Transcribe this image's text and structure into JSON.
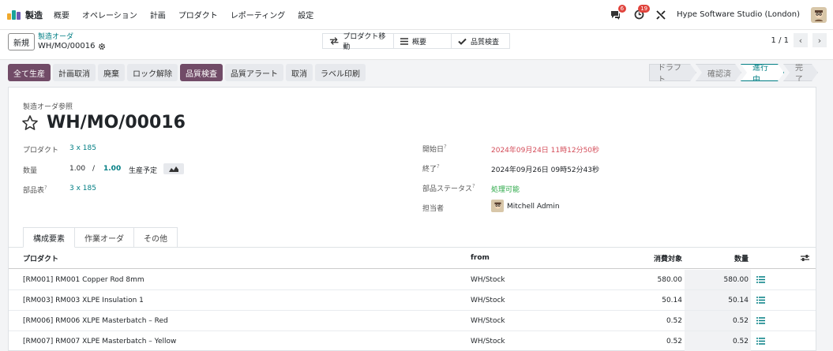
{
  "app": {
    "name": "製造",
    "menu": [
      "概要",
      "オペレーション",
      "計画",
      "プロダクト",
      "レポーティング",
      "設定"
    ]
  },
  "systray": {
    "messages_count": "6",
    "activities_count": "19",
    "company": "Hype Software Studio (London)"
  },
  "control": {
    "new_label": "新規",
    "breadcrumb_parent": "製造オーダ",
    "breadcrumb_current": "WH/MO/00016",
    "smart_buttons": [
      "プロダクト移動",
      "概要",
      "品質検査"
    ],
    "pager": "1 / 1"
  },
  "actions": [
    "全て生産",
    "計画取消",
    "廃棄",
    "ロック解除",
    "品質検査",
    "品質アラート",
    "取消",
    "ラベル印刷"
  ],
  "stages": [
    "ドラフト",
    "確認済",
    "進行中",
    "完了"
  ],
  "form": {
    "ref_label": "製造オーダ参照",
    "title": "WH/MO/00016",
    "product_label": "プロダクト",
    "product_value": "3 x 185",
    "qty_label": "数量",
    "qty_value": "1.00",
    "qty_sep": "/",
    "qty_target": "1.00",
    "forecast_label": "生産予定",
    "bom_label": "部品表",
    "bom_value": "3 x 185",
    "start_label": "開始日",
    "start_value": "2024年09月24日 11時12分50秒",
    "end_label": "終了",
    "end_value": "2024年09月26日 09時52分43秒",
    "component_status_label": "部品ステータス",
    "component_status_value": "処理可能",
    "responsible_label": "担当者",
    "responsible_value": "Mitchell Admin",
    "help_mark": "?"
  },
  "tabs": [
    "構成要素",
    "作業オーダ",
    "その他"
  ],
  "table": {
    "headers": {
      "product": "プロダクト",
      "from": "from",
      "to_consume": "消費対象",
      "quantity": "数量"
    },
    "rows": [
      {
        "product": "[RM001] RM001 Copper Rod 8mm",
        "from": "WH/Stock",
        "to_consume": "580.00",
        "quantity": "580.00"
      },
      {
        "product": "[RM003] RM003 XLPE Insulation 1",
        "from": "WH/Stock",
        "to_consume": "50.14",
        "quantity": "50.14"
      },
      {
        "product": "[RM006] RM006 XLPE Masterbatch – Red",
        "from": "WH/Stock",
        "to_consume": "0.52",
        "quantity": "0.52"
      },
      {
        "product": "[RM007] RM007 XLPE Masterbatch – Yellow",
        "from": "WH/Stock",
        "to_consume": "0.52",
        "quantity": "0.52"
      }
    ]
  },
  "colors": {
    "primary": "#714b67",
    "accent": "#017e84",
    "danger": "#d44c59",
    "success": "#28a745"
  }
}
